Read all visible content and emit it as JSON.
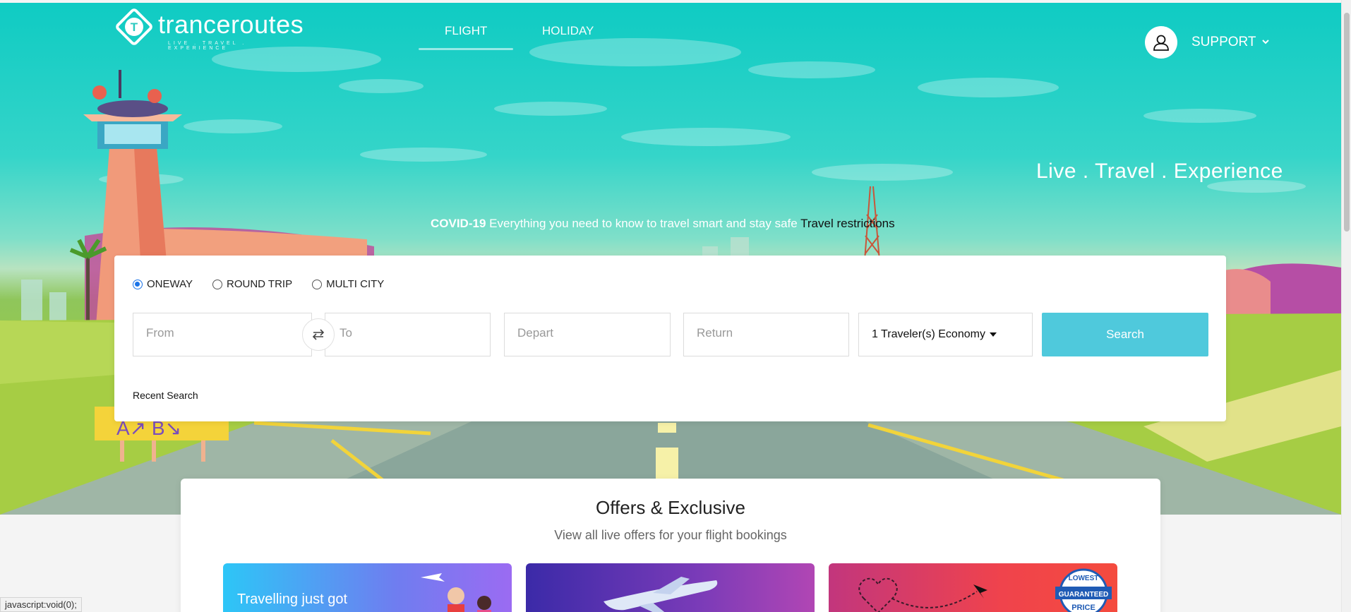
{
  "header": {
    "logo_word": "tranceroutes",
    "logo_tagline": "LIVE . TRAVEL . EXPERIENCE",
    "nav": [
      {
        "label": "FLIGHT",
        "active": true
      },
      {
        "label": "HOLIDAY",
        "active": false
      }
    ],
    "support_label": "SUPPORT",
    "user_icon": "user-icon"
  },
  "hero": {
    "tagline": "Live . Travel . Experience",
    "covid_bold": "COVID-19",
    "covid_text": " Everything you need to know to travel smart and stay safe ",
    "covid_link": "Travel restrictions"
  },
  "search": {
    "trip_types": [
      "ONEWAY",
      "ROUND TRIP",
      "MULTI CITY"
    ],
    "selected_trip": "ONEWAY",
    "from_placeholder": "From",
    "to_placeholder": "To",
    "depart_placeholder": "Depart",
    "return_placeholder": "Return",
    "travellers": "1 Traveler(s) Economy",
    "search_label": "Search",
    "recent_label": "Recent Search",
    "swap_icon": "swap-icon"
  },
  "offers": {
    "title": "Offers & Exclusive",
    "subtitle": "View all live offers for your flight bookings",
    "card1_text": "Travelling just got",
    "badge_lines": [
      "LOWEST",
      "GUARANTEED",
      "PRICE"
    ]
  },
  "status": "javascript:void(0);",
  "colors": {
    "sky": "#0fcbc3",
    "search_button": "#4fc9dc",
    "radio_active": "#1a73e8"
  }
}
